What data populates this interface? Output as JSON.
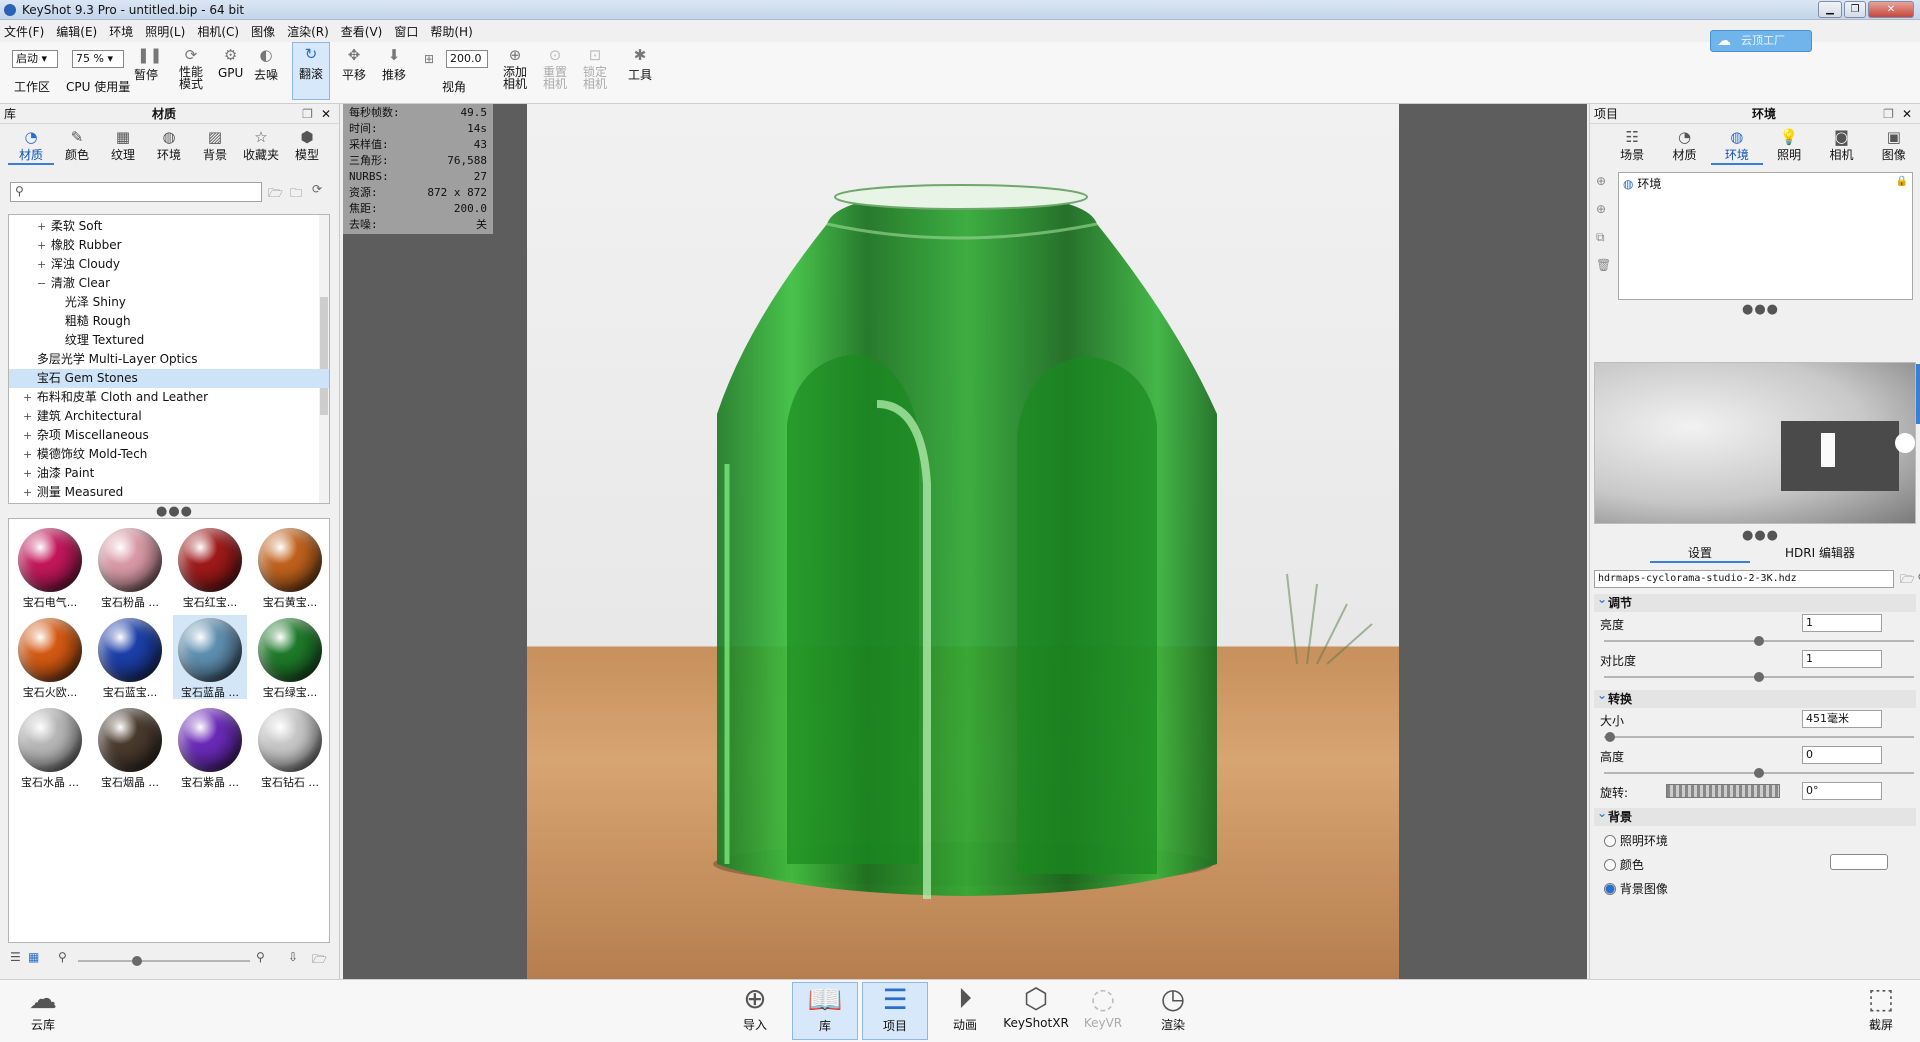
{
  "titlebar": {
    "title": "KeyShot 9.3 Pro  - untitled.bip  - 64 bit"
  },
  "menu": [
    "文件(F)",
    "编辑(E)",
    "环境",
    "照明(L)",
    "相机(C)",
    "图像",
    "渲染(R)",
    "查看(V)",
    "窗口",
    "帮助(H)"
  ],
  "toolbar": {
    "workspace_value": "启动",
    "workspace_label": "工作区",
    "cpu_value": "75 %",
    "cpu_label": "CPU 使用量",
    "pause": "暂停",
    "perf": "性能\n模式",
    "gpu": "GPU",
    "denoise": "去噪",
    "tumble": "翻滚",
    "pan": "平移",
    "dolly": "推移",
    "fov_value": "200.0",
    "fov_label": "视角",
    "add_camera": "添加\n相机",
    "reset_camera": "重置\n相机",
    "lock_camera": "锁定\n相机",
    "tools": "工具",
    "cloud_badge": "云顶工厂"
  },
  "library": {
    "title_left": "库",
    "title": "材质",
    "tabs": [
      {
        "label": "材质",
        "icon": "material-icon"
      },
      {
        "label": "颜色",
        "icon": "color-icon"
      },
      {
        "label": "纹理",
        "icon": "texture-icon"
      },
      {
        "label": "环境",
        "icon": "environment-icon"
      },
      {
        "label": "背景",
        "icon": "background-icon"
      },
      {
        "label": "收藏夹",
        "icon": "favorites-icon"
      },
      {
        "label": "模型",
        "icon": "model-icon"
      }
    ],
    "search_placeholder": "",
    "tree": [
      {
        "label": "柔软 Soft",
        "expander": "+",
        "indent": 2
      },
      {
        "label": "橡胶 Rubber",
        "expander": "+",
        "indent": 2
      },
      {
        "label": "浑浊 Cloudy",
        "expander": "+",
        "indent": 2
      },
      {
        "label": "清澈 Clear",
        "expander": "−",
        "indent": 2
      },
      {
        "label": "光泽 Shiny",
        "expander": "",
        "indent": 3
      },
      {
        "label": "粗糙 Rough",
        "expander": "",
        "indent": 3
      },
      {
        "label": "纹理 Textured",
        "expander": "",
        "indent": 3
      },
      {
        "label": "多层光学 Multi-Layer Optics",
        "expander": "",
        "indent": 1
      },
      {
        "label": "宝石 Gem Stones",
        "expander": "",
        "indent": 1,
        "selected": true
      },
      {
        "label": "布料和皮革 Cloth and Leather",
        "expander": "+",
        "indent": 1
      },
      {
        "label": "建筑 Architectural",
        "expander": "+",
        "indent": 1
      },
      {
        "label": "杂项 Miscellaneous",
        "expander": "+",
        "indent": 1
      },
      {
        "label": "模德饰纹 Mold-Tech",
        "expander": "+",
        "indent": 1
      },
      {
        "label": "油漆 Paint",
        "expander": "+",
        "indent": 1
      },
      {
        "label": "测量 Measured",
        "expander": "+",
        "indent": 1
      }
    ],
    "thumbs": [
      {
        "label": "宝石电气...",
        "color": "#c2185b"
      },
      {
        "label": "宝石粉晶 ...",
        "color": "#d99aa6"
      },
      {
        "label": "宝石红宝...",
        "color": "#9e1a1a"
      },
      {
        "label": "宝石黄宝...",
        "color": "#c0621c"
      },
      {
        "label": "宝石火欧...",
        "color": "#d45a12"
      },
      {
        "label": "宝石蓝宝...",
        "color": "#1c3fa8"
      },
      {
        "label": "宝石蓝晶 ...",
        "color": "#5f8fb0",
        "selected": true
      },
      {
        "label": "宝石绿宝...",
        "color": "#1e7a2a"
      },
      {
        "label": "宝石水晶 ...",
        "color": "#b8b8b8"
      },
      {
        "label": "宝石烟晶 ...",
        "color": "#4a3a2e"
      },
      {
        "label": "宝石紫晶 ...",
        "color": "#6a2ab8"
      },
      {
        "label": "宝石钻石 ...",
        "color": "#c8c8c8"
      }
    ]
  },
  "stats": [
    {
      "k": "每秒帧数:",
      "v": "49.5"
    },
    {
      "k": "时间:",
      "v": "14s"
    },
    {
      "k": "采样值:",
      "v": "43"
    },
    {
      "k": "三角形:",
      "v": "76,588"
    },
    {
      "k": "NURBS:",
      "v": "27"
    },
    {
      "k": "资源:",
      "v": "872 x 872"
    },
    {
      "k": "焦距:",
      "v": "200.0"
    },
    {
      "k": "去噪:",
      "v": "关"
    }
  ],
  "project": {
    "title_left": "项目",
    "title": "环境",
    "tabs": [
      {
        "label": "场景",
        "icon": "scene-icon"
      },
      {
        "label": "材质",
        "icon": "material-icon"
      },
      {
        "label": "环境",
        "icon": "environment-icon"
      },
      {
        "label": "照明",
        "icon": "lighting-icon"
      },
      {
        "label": "相机",
        "icon": "camera-icon"
      },
      {
        "label": "图像",
        "icon": "image-icon"
      }
    ],
    "env_item": "环境",
    "subtabs": {
      "settings": "设置",
      "hdri": "HDRI 编辑器"
    },
    "hdri_file": "hdrmaps-cyclorama-studio-2-3K.hdz",
    "adjust": {
      "header": "调节",
      "brightness_label": "亮度",
      "brightness": "1",
      "brightness_level": 0.5,
      "contrast_label": "对比度",
      "contrast": "1",
      "contrast_level": 0.5
    },
    "transform": {
      "header": "转换",
      "size_label": "大小",
      "size": "451毫米",
      "size_level": 0.02,
      "height_label": "高度",
      "height": "0",
      "height_level": 0.5,
      "rotation_label": "旋转:",
      "rotation": "0°"
    },
    "background": {
      "header": "背景",
      "options": [
        {
          "label": "照明环境",
          "checked": false
        },
        {
          "label": "颜色",
          "checked": false
        },
        {
          "label": "背景图像",
          "checked": true
        }
      ]
    }
  },
  "bottombar": {
    "cloud": "云库",
    "items": [
      {
        "label": "导入",
        "icon": "import-icon"
      },
      {
        "label": "库",
        "icon": "library-icon",
        "active": true
      },
      {
        "label": "项目",
        "icon": "project-icon",
        "active": true
      },
      {
        "label": "动画",
        "icon": "animation-icon"
      },
      {
        "label": "KeyShotXR",
        "icon": "keyshotxr-icon"
      },
      {
        "label": "KeyVR",
        "icon": "keyvr-icon",
        "disabled": true
      },
      {
        "label": "渲染",
        "icon": "render-icon"
      }
    ],
    "screenshot": "截屏"
  }
}
